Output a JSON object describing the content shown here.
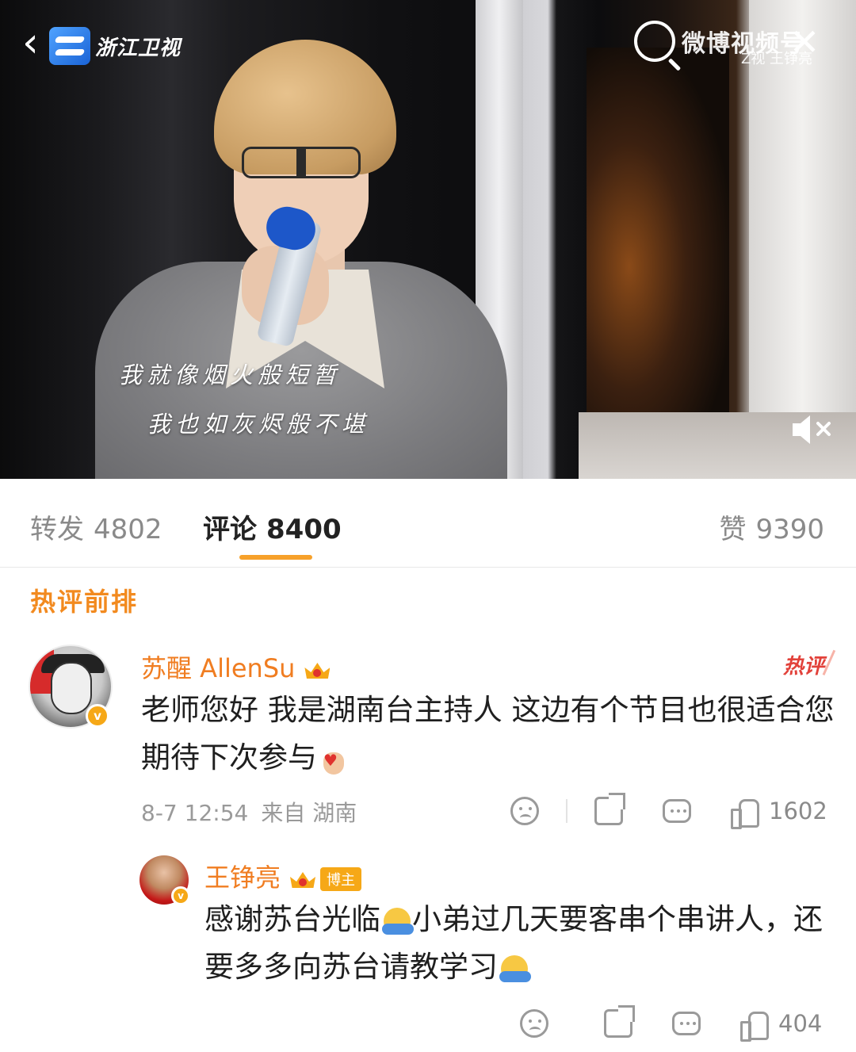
{
  "video": {
    "channel_name": "浙江卫视",
    "watermark_text": "微博视频号",
    "corner_watermark": "Z视 王铮亮",
    "subtitle_line1": "我就像烟火般短暂",
    "subtitle_line2": "我也如灰烬般不堪",
    "icons": {
      "back": "chevron-left-icon",
      "close": "close-icon",
      "mute": "speaker-mute-icon"
    }
  },
  "tabs": {
    "repost_label": "转发",
    "repost_count": "4802",
    "comment_label": "评论",
    "comment_count": "8400",
    "like_label": "赞",
    "like_count": "9390",
    "active": "comments",
    "accent_color": "#f7a12a"
  },
  "section_title": "热评前排",
  "comments": [
    {
      "username": "苏醒 AllenSu",
      "badge": "crown-icon",
      "hot_tag": "热评",
      "text_part1": "老师您好 我是湖南台主持人 这边有个节目也很适合您 期待下次参与",
      "emoji": "heart-hand-emoji",
      "time": "8-7 12:54",
      "location": "来自 湖南",
      "like_count": "1602"
    },
    {
      "username": "王铮亮",
      "badge": "crown-icon",
      "host_badge": "博主",
      "text_part1": "感谢苏台光临",
      "text_part2": "小弟过几天要客串个串讲人，还要多多向苏台请教学习",
      "emoji": "hug-emoji",
      "like_count": "404"
    }
  ],
  "colors": {
    "username": "#f07d21",
    "section_title": "#f28a1f",
    "hot_tag": "#e2413a",
    "verified_badge": "#f6a817"
  }
}
